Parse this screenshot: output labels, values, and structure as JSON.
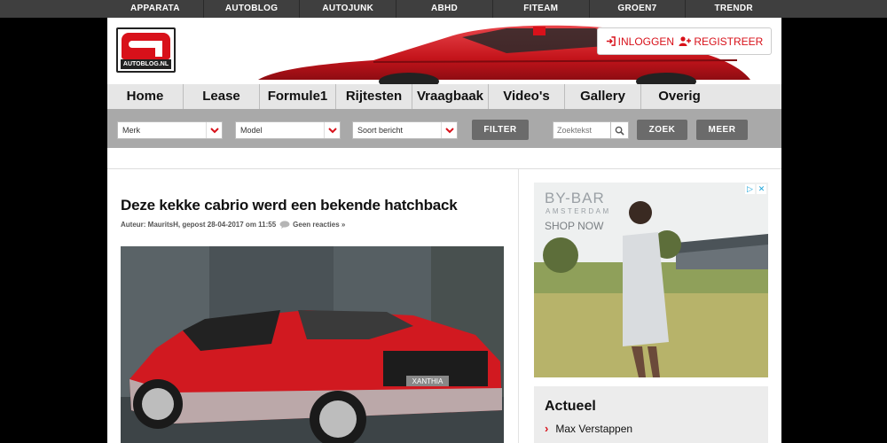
{
  "network": [
    "APPARATA",
    "AUTOBLOG",
    "AUTOJUNK",
    "ABHD",
    "FITEAM",
    "GROEN7",
    "TRENDR"
  ],
  "header": {
    "logo_text": "AUTOBLOG.NL",
    "login_label": "INLOGGEN",
    "register_label": "REGISTREER"
  },
  "nav": [
    "Home",
    "Lease",
    "Formule1",
    "Rijtesten",
    "Vraagbaak",
    "Video's",
    "Gallery",
    "Overig"
  ],
  "filter": {
    "merk": "Merk",
    "model": "Model",
    "soort": "Soort bericht",
    "filter_label": "FILTER",
    "search_placeholder": "Zoektekst",
    "zoek_label": "ZOEK",
    "meer_label": "MEER"
  },
  "article": {
    "title": "Deze kekke cabrio werd een bekende hatchback",
    "meta": "Auteur: MauritsH, gepost 28-04-2017 om 11:55",
    "comments": "Geen reacties »",
    "plate": "XANTHIA"
  },
  "ad": {
    "brand": "BY-BAR",
    "city": "AMSTERDAM",
    "cta": "SHOP NOW"
  },
  "sidebar": {
    "actueel_title": "Actueel",
    "items": [
      "Max Verstappen"
    ]
  },
  "colors": {
    "accent": "#d8111a",
    "topbar": "#3f3f3f",
    "nav": "#e6e6e6",
    "filterbar": "#a9a9a9"
  }
}
